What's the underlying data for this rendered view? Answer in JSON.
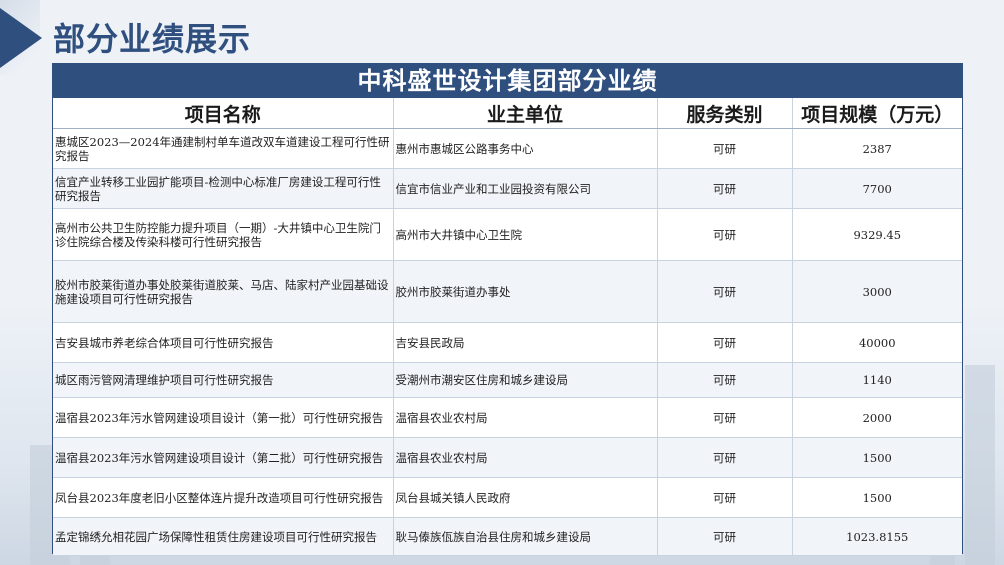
{
  "page": {
    "title": "部分业绩展示"
  },
  "table": {
    "caption": "中科盛世设计集团部分业绩",
    "headers": [
      "项目名称",
      "业主单位",
      "服务类别",
      "项目规模（万元）"
    ],
    "rows": [
      {
        "name": "惠城区2023—2024年通建制村单车道改双车道建设工程可行性研究报告",
        "owner": "惠州市惠城区公路事务中心",
        "type": "可研",
        "scale": "2387"
      },
      {
        "name": "信宜产业转移工业园扩能项目-检测中心标准厂房建设工程可行性研究报告",
        "owner": "信宜市信业产业和工业园投资有限公司",
        "type": "可研",
        "scale": "7700"
      },
      {
        "name": "高州市公共卫生防控能力提升项目（一期）-大井镇中心卫生院门诊住院综合楼及传染科楼可行性研究报告",
        "owner": "高州市大井镇中心卫生院",
        "type": "可研",
        "scale": "9329.45"
      },
      {
        "name": "胶州市胶莱街道办事处胶莱街道胶莱、马店、陆家村产业园基础设施建设项目可行性研究报告",
        "owner": "胶州市胶莱街道办事处",
        "type": "可研",
        "scale": "3000"
      },
      {
        "name": "吉安县城市养老综合体项目可行性研究报告",
        "owner": "吉安县民政局",
        "type": "可研",
        "scale": "40000"
      },
      {
        "name": "城区雨污管网清理维护项目可行性研究报告",
        "owner": "受潮州市潮安区住房和城乡建设局",
        "type": "可研",
        "scale": "1140"
      },
      {
        "name": "温宿县2023年污水管网建设项目设计（第一批）可行性研究报告",
        "owner": "温宿县农业农村局",
        "type": "可研",
        "scale": "2000"
      },
      {
        "name": "温宿县2023年污水管网建设项目设计（第二批）可行性研究报告",
        "owner": "温宿县农业农村局",
        "type": "可研",
        "scale": "1500"
      },
      {
        "name": "凤台县2023年度老旧小区整体连片提升改造项目可行性研究报告",
        "owner": "凤台县城关镇人民政府",
        "type": "可研",
        "scale": "1500"
      },
      {
        "name": "孟定锦绣允相花园广场保障性租赁住房建设项目可行性研究报告",
        "owner": "耿马傣族佤族自治县住房和城乡建设局",
        "type": "可研",
        "scale": "1023.8155"
      }
    ]
  },
  "colors": {
    "primary": "#2f4f7f",
    "row_alt": "#f1f4f8"
  },
  "icons": {
    "title_marker": "triangle-arrow-icon"
  }
}
